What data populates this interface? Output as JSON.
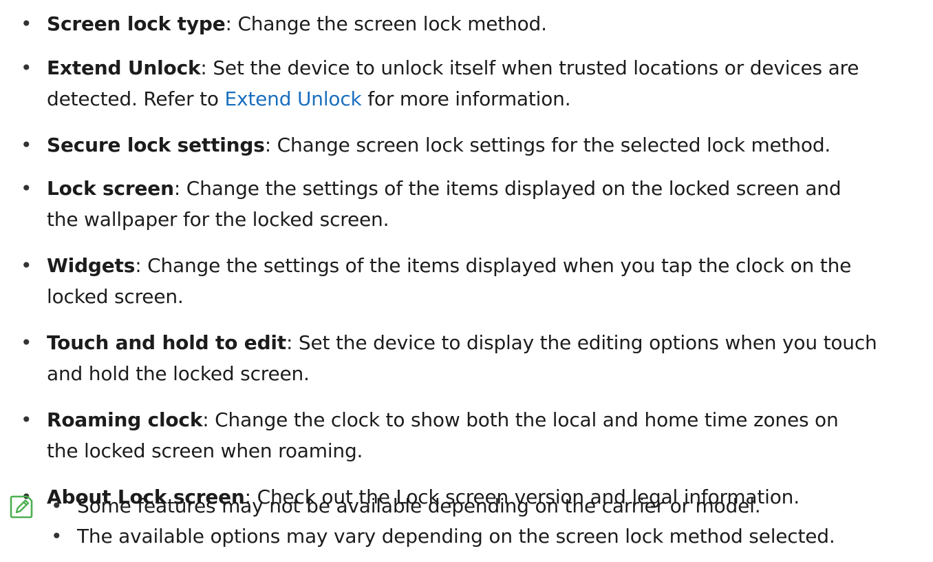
{
  "bullet_glyph": "•",
  "items": [
    {
      "term": "Screen lock type",
      "desc": ": Change the screen lock method."
    },
    {
      "term": "Extend Unlock",
      "desc": ": Set the device to unlock itself when trusted locations or devices are",
      "line2_pre": "detected. Refer to ",
      "line2_link": "Extend Unlock",
      "line2_post": " for more information."
    },
    {
      "term": "Secure lock settings",
      "desc": ": Change screen lock settings for the selected lock method."
    },
    {
      "term": "Lock screen",
      "desc": ": Change the settings of the items displayed on the locked screen and",
      "line2": "the wallpaper for the locked screen."
    },
    {
      "term": "Widgets",
      "desc": ": Change the settings of the items displayed when you tap the clock on the",
      "line2": "locked screen."
    },
    {
      "term": "Touch and hold to edit",
      "desc": ": Set the device to display the editing options when you touch",
      "line2": "and hold the locked screen."
    },
    {
      "term": "Roaming clock",
      "desc": ": Change the clock to show both the local and home time zones on",
      "line2": "the locked screen when roaming."
    },
    {
      "term": "About Lock screen",
      "desc": ": Check out the Lock screen version and legal information."
    }
  ],
  "notes": [
    "Some features may not be available depending on the carrier or model.",
    "The available options may vary depending on the screen lock method selected."
  ],
  "colors": {
    "link": "#1a6fbf",
    "note_icon": "#4caf50"
  },
  "icon": "note-pencil-icon"
}
